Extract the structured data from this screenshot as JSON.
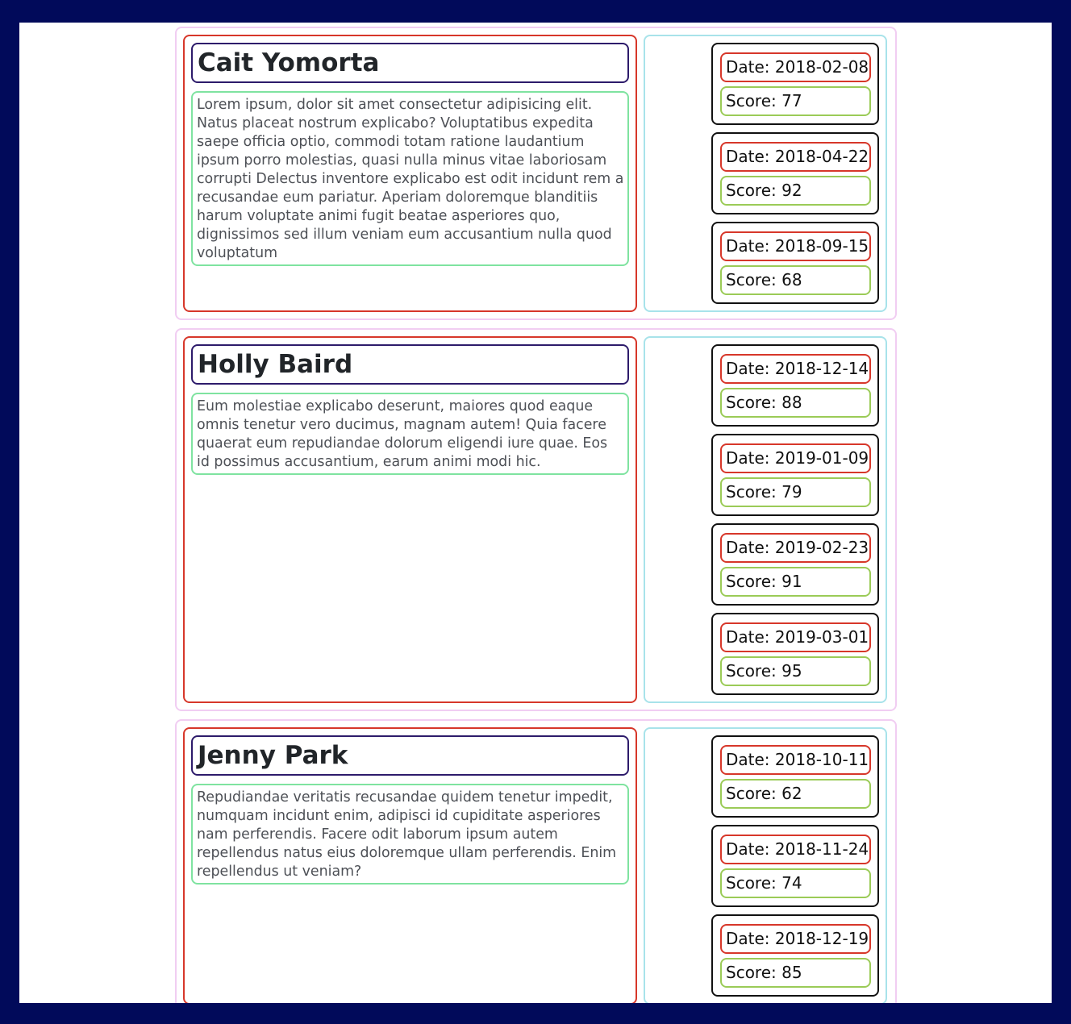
{
  "labels": {
    "date_prefix": "Date: ",
    "score_prefix": "Score: "
  },
  "colors": {
    "page_background": "#010a5a",
    "card_border": "#f1cdf2",
    "left_panel_border": "#d7372a",
    "name_border": "#2d1b6b",
    "bio_border": "#7fe3a0",
    "right_panel_border": "#a8e3ea",
    "entry_border": "#111111",
    "date_border": "#d7372a",
    "score_border": "#9bcb57"
  },
  "people": [
    {
      "name": "Cait Yomorta",
      "bio": "Lorem ipsum, dolor sit amet consectetur adipisicing elit. Natus placeat nostrum explicabo? Voluptatibus expedita saepe officia optio, commodi totam ratione laudantium ipsum porro molestias, quasi nulla minus vitae laboriosam corrupti Delectus inventore explicabo est odit incidunt rem a recusandae eum pariatur. Aperiam doloremque blanditiis harum voluptate animi fugit beatae asperiores quo, dignissimos sed illum veniam eum accusantium nulla quod voluptatum",
      "scores": [
        {
          "date": "2018-02-08",
          "score": "77"
        },
        {
          "date": "2018-04-22",
          "score": "92"
        },
        {
          "date": "2018-09-15",
          "score": "68"
        }
      ]
    },
    {
      "name": "Holly Baird",
      "bio": "Eum molestiae explicabo deserunt, maiores quod eaque omnis tenetur vero ducimus, magnam autem! Quia facere quaerat eum repudiandae dolorum eligendi iure quae. Eos id possimus accusantium, earum animi modi hic.",
      "scores": [
        {
          "date": "2018-12-14",
          "score": "88"
        },
        {
          "date": "2019-01-09",
          "score": "79"
        },
        {
          "date": "2019-02-23",
          "score": "91"
        },
        {
          "date": "2019-03-01",
          "score": "95"
        }
      ]
    },
    {
      "name": "Jenny Park",
      "bio": "Repudiandae veritatis recusandae quidem tenetur impedit, numquam incidunt enim, adipisci id cupiditate asperiores nam perferendis. Facere odit laborum ipsum autem repellendus natus eius doloremque ullam perferendis. Enim repellendus ut veniam?",
      "scores": [
        {
          "date": "2018-10-11",
          "score": "62"
        },
        {
          "date": "2018-11-24",
          "score": "74"
        },
        {
          "date": "2018-12-19",
          "score": "85"
        }
      ]
    }
  ]
}
